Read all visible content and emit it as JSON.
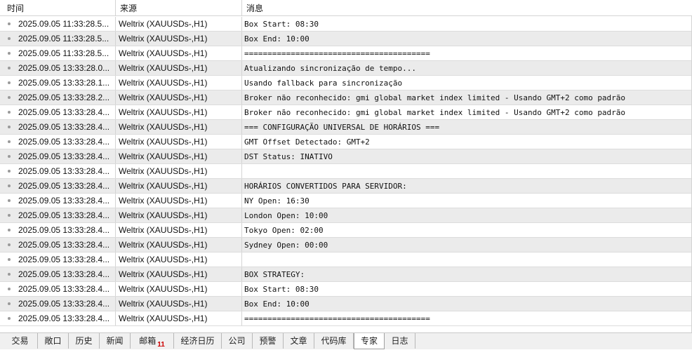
{
  "columns": {
    "time": "时间",
    "source": "来源",
    "message": "消息"
  },
  "rows": [
    {
      "time": "2025.09.05 11:33:28.5...",
      "source": "Weltrix (XAUUSDs-,H1)",
      "message": "Box Start: 08:30"
    },
    {
      "time": "2025.09.05 11:33:28.5...",
      "source": "Weltrix (XAUUSDs-,H1)",
      "message": "Box End: 10:00"
    },
    {
      "time": "2025.09.05 11:33:28.5...",
      "source": "Weltrix (XAUUSDs-,H1)",
      "message": "========================================"
    },
    {
      "time": "2025.09.05 13:33:28.0...",
      "source": "Weltrix (XAUUSDs-,H1)",
      "message": "Atualizando sincronização de tempo..."
    },
    {
      "time": "2025.09.05 13:33:28.1...",
      "source": "Weltrix (XAUUSDs-,H1)",
      "message": "Usando fallback para sincronização"
    },
    {
      "time": "2025.09.05 13:33:28.2...",
      "source": "Weltrix (XAUUSDs-,H1)",
      "message": "Broker não reconhecido: gmi global market index limited - Usando GMT+2 como padrão"
    },
    {
      "time": "2025.09.05 13:33:28.4...",
      "source": "Weltrix (XAUUSDs-,H1)",
      "message": "Broker não reconhecido: gmi global market index limited - Usando GMT+2 como padrão"
    },
    {
      "time": "2025.09.05 13:33:28.4...",
      "source": "Weltrix (XAUUSDs-,H1)",
      "message": "=== CONFIGURAÇÃO UNIVERSAL DE HORÁRIOS ==="
    },
    {
      "time": "2025.09.05 13:33:28.4...",
      "source": "Weltrix (XAUUSDs-,H1)",
      "message": "GMT Offset Detectado: GMT+2"
    },
    {
      "time": "2025.09.05 13:33:28.4...",
      "source": "Weltrix (XAUUSDs-,H1)",
      "message": "DST Status: INATIVO"
    },
    {
      "time": "2025.09.05 13:33:28.4...",
      "source": "Weltrix (XAUUSDs-,H1)",
      "message": ""
    },
    {
      "time": "2025.09.05 13:33:28.4...",
      "source": "Weltrix (XAUUSDs-,H1)",
      "message": "HORÁRIOS CONVERTIDOS PARA SERVIDOR:"
    },
    {
      "time": "2025.09.05 13:33:28.4...",
      "source": "Weltrix (XAUUSDs-,H1)",
      "message": "NY Open: 16:30"
    },
    {
      "time": "2025.09.05 13:33:28.4...",
      "source": "Weltrix (XAUUSDs-,H1)",
      "message": "London Open: 10:00"
    },
    {
      "time": "2025.09.05 13:33:28.4...",
      "source": "Weltrix (XAUUSDs-,H1)",
      "message": "Tokyo Open: 02:00"
    },
    {
      "time": "2025.09.05 13:33:28.4...",
      "source": "Weltrix (XAUUSDs-,H1)",
      "message": "Sydney Open: 00:00"
    },
    {
      "time": "2025.09.05 13:33:28.4...",
      "source": "Weltrix (XAUUSDs-,H1)",
      "message": ""
    },
    {
      "time": "2025.09.05 13:33:28.4...",
      "source": "Weltrix (XAUUSDs-,H1)",
      "message": "BOX STRATEGY:"
    },
    {
      "time": "2025.09.05 13:33:28.4...",
      "source": "Weltrix (XAUUSDs-,H1)",
      "message": "Box Start: 08:30"
    },
    {
      "time": "2025.09.05 13:33:28.4...",
      "source": "Weltrix (XAUUSDs-,H1)",
      "message": "Box End: 10:00"
    },
    {
      "time": "2025.09.05 13:33:28.4...",
      "source": "Weltrix (XAUUSDs-,H1)",
      "message": "========================================"
    }
  ],
  "tabs": [
    {
      "label": "交易",
      "active": false
    },
    {
      "label": "敞口",
      "active": false
    },
    {
      "label": "历史",
      "active": false
    },
    {
      "label": "新闻",
      "active": false
    },
    {
      "label": "邮箱",
      "active": false,
      "badge": "11"
    },
    {
      "label": "经济日历",
      "active": false
    },
    {
      "label": "公司",
      "active": false
    },
    {
      "label": "预警",
      "active": false
    },
    {
      "label": "文章",
      "active": false
    },
    {
      "label": "代码库",
      "active": false
    },
    {
      "label": "专家",
      "active": true
    },
    {
      "label": "日志",
      "active": false
    }
  ],
  "icons": {
    "row_marker": "bullet-dot-icon"
  },
  "colors": {
    "row_alt_background": "#ebebeb",
    "badge": "#cc0000"
  }
}
